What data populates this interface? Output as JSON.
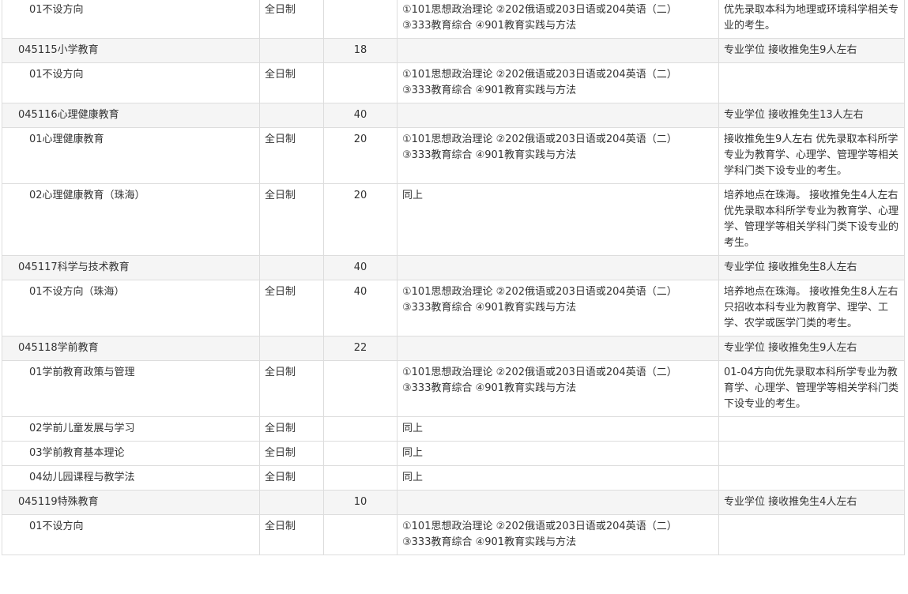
{
  "rows": [
    {
      "type": "minor",
      "name": "01不设方向",
      "mode": "全日制",
      "count": "",
      "exam": [
        "①101思想政治理论 ②202俄语或203日语或204英语（二）",
        "③333教育综合 ④901教育实践与方法"
      ],
      "note": "优先录取本科为地理或环境科学相关专业的考生。"
    },
    {
      "type": "major",
      "name": "045115小学教育",
      "mode": "",
      "count": "18",
      "exam": [
        "",
        ""
      ],
      "note": "专业学位 接收推免生9人左右"
    },
    {
      "type": "minor",
      "name": "01不设方向",
      "mode": "全日制",
      "count": "",
      "exam": [
        "①101思想政治理论 ②202俄语或203日语或204英语（二）",
        "③333教育综合 ④901教育实践与方法"
      ],
      "note": ""
    },
    {
      "type": "major",
      "name": "045116心理健康教育",
      "mode": "",
      "count": "40",
      "exam": [
        "",
        ""
      ],
      "note": "专业学位 接收推免生13人左右"
    },
    {
      "type": "minor",
      "name": "01心理健康教育",
      "mode": "全日制",
      "count": "20",
      "exam": [
        "①101思想政治理论 ②202俄语或203日语或204英语（二）",
        "③333教育综合 ④901教育实践与方法"
      ],
      "note": "接收推免生9人左右 优先录取本科所学专业为教育学、心理学、管理学等相关学科门类下设专业的考生。"
    },
    {
      "type": "minor",
      "name": "02心理健康教育（珠海）",
      "mode": "全日制",
      "count": "20",
      "exam": [
        "同上",
        ""
      ],
      "note": "培养地点在珠海。 接收推免生4人左右 优先录取本科所学专业为教育学、心理学、管理学等相关学科门类下设专业的考生。"
    },
    {
      "type": "major",
      "name": "045117科学与技术教育",
      "mode": "",
      "count": "40",
      "exam": [
        "",
        ""
      ],
      "note": "专业学位 接收推免生8人左右"
    },
    {
      "type": "minor",
      "name": "01不设方向（珠海）",
      "mode": "全日制",
      "count": "40",
      "exam": [
        "①101思想政治理论 ②202俄语或203日语或204英语（二）",
        "③333教育综合 ④901教育实践与方法"
      ],
      "note": "培养地点在珠海。 接收推免生8人左右 只招收本科专业为教育学、理学、工学、农学或医学门类的考生。"
    },
    {
      "type": "major",
      "name": "045118学前教育",
      "mode": "",
      "count": "22",
      "exam": [
        "",
        ""
      ],
      "note": "专业学位 接收推免生9人左右"
    },
    {
      "type": "minor",
      "name": "01学前教育政策与管理",
      "mode": "全日制",
      "count": "",
      "exam": [
        "①101思想政治理论 ②202俄语或203日语或204英语（二）",
        "③333教育综合 ④901教育实践与方法"
      ],
      "note": "01-04方向优先录取本科所学专业为教育学、心理学、管理学等相关学科门类下设专业的考生。"
    },
    {
      "type": "minor",
      "name": "02学前儿童发展与学习",
      "mode": "全日制",
      "count": "",
      "exam": [
        "同上",
        ""
      ],
      "note": ""
    },
    {
      "type": "minor",
      "name": "03学前教育基本理论",
      "mode": "全日制",
      "count": "",
      "exam": [
        "同上",
        ""
      ],
      "note": ""
    },
    {
      "type": "minor",
      "name": "04幼儿园课程与教学法",
      "mode": "全日制",
      "count": "",
      "exam": [
        "同上",
        ""
      ],
      "note": ""
    },
    {
      "type": "major",
      "name": "045119特殊教育",
      "mode": "",
      "count": "10",
      "exam": [
        "",
        ""
      ],
      "note": "专业学位 接收推免生4人左右"
    },
    {
      "type": "minor",
      "name": "01不设方向",
      "mode": "全日制",
      "count": "",
      "exam": [
        "①101思想政治理论 ②202俄语或203日语或204英语（二）",
        "③333教育综合 ④901教育实践与方法"
      ],
      "note": ""
    }
  ]
}
